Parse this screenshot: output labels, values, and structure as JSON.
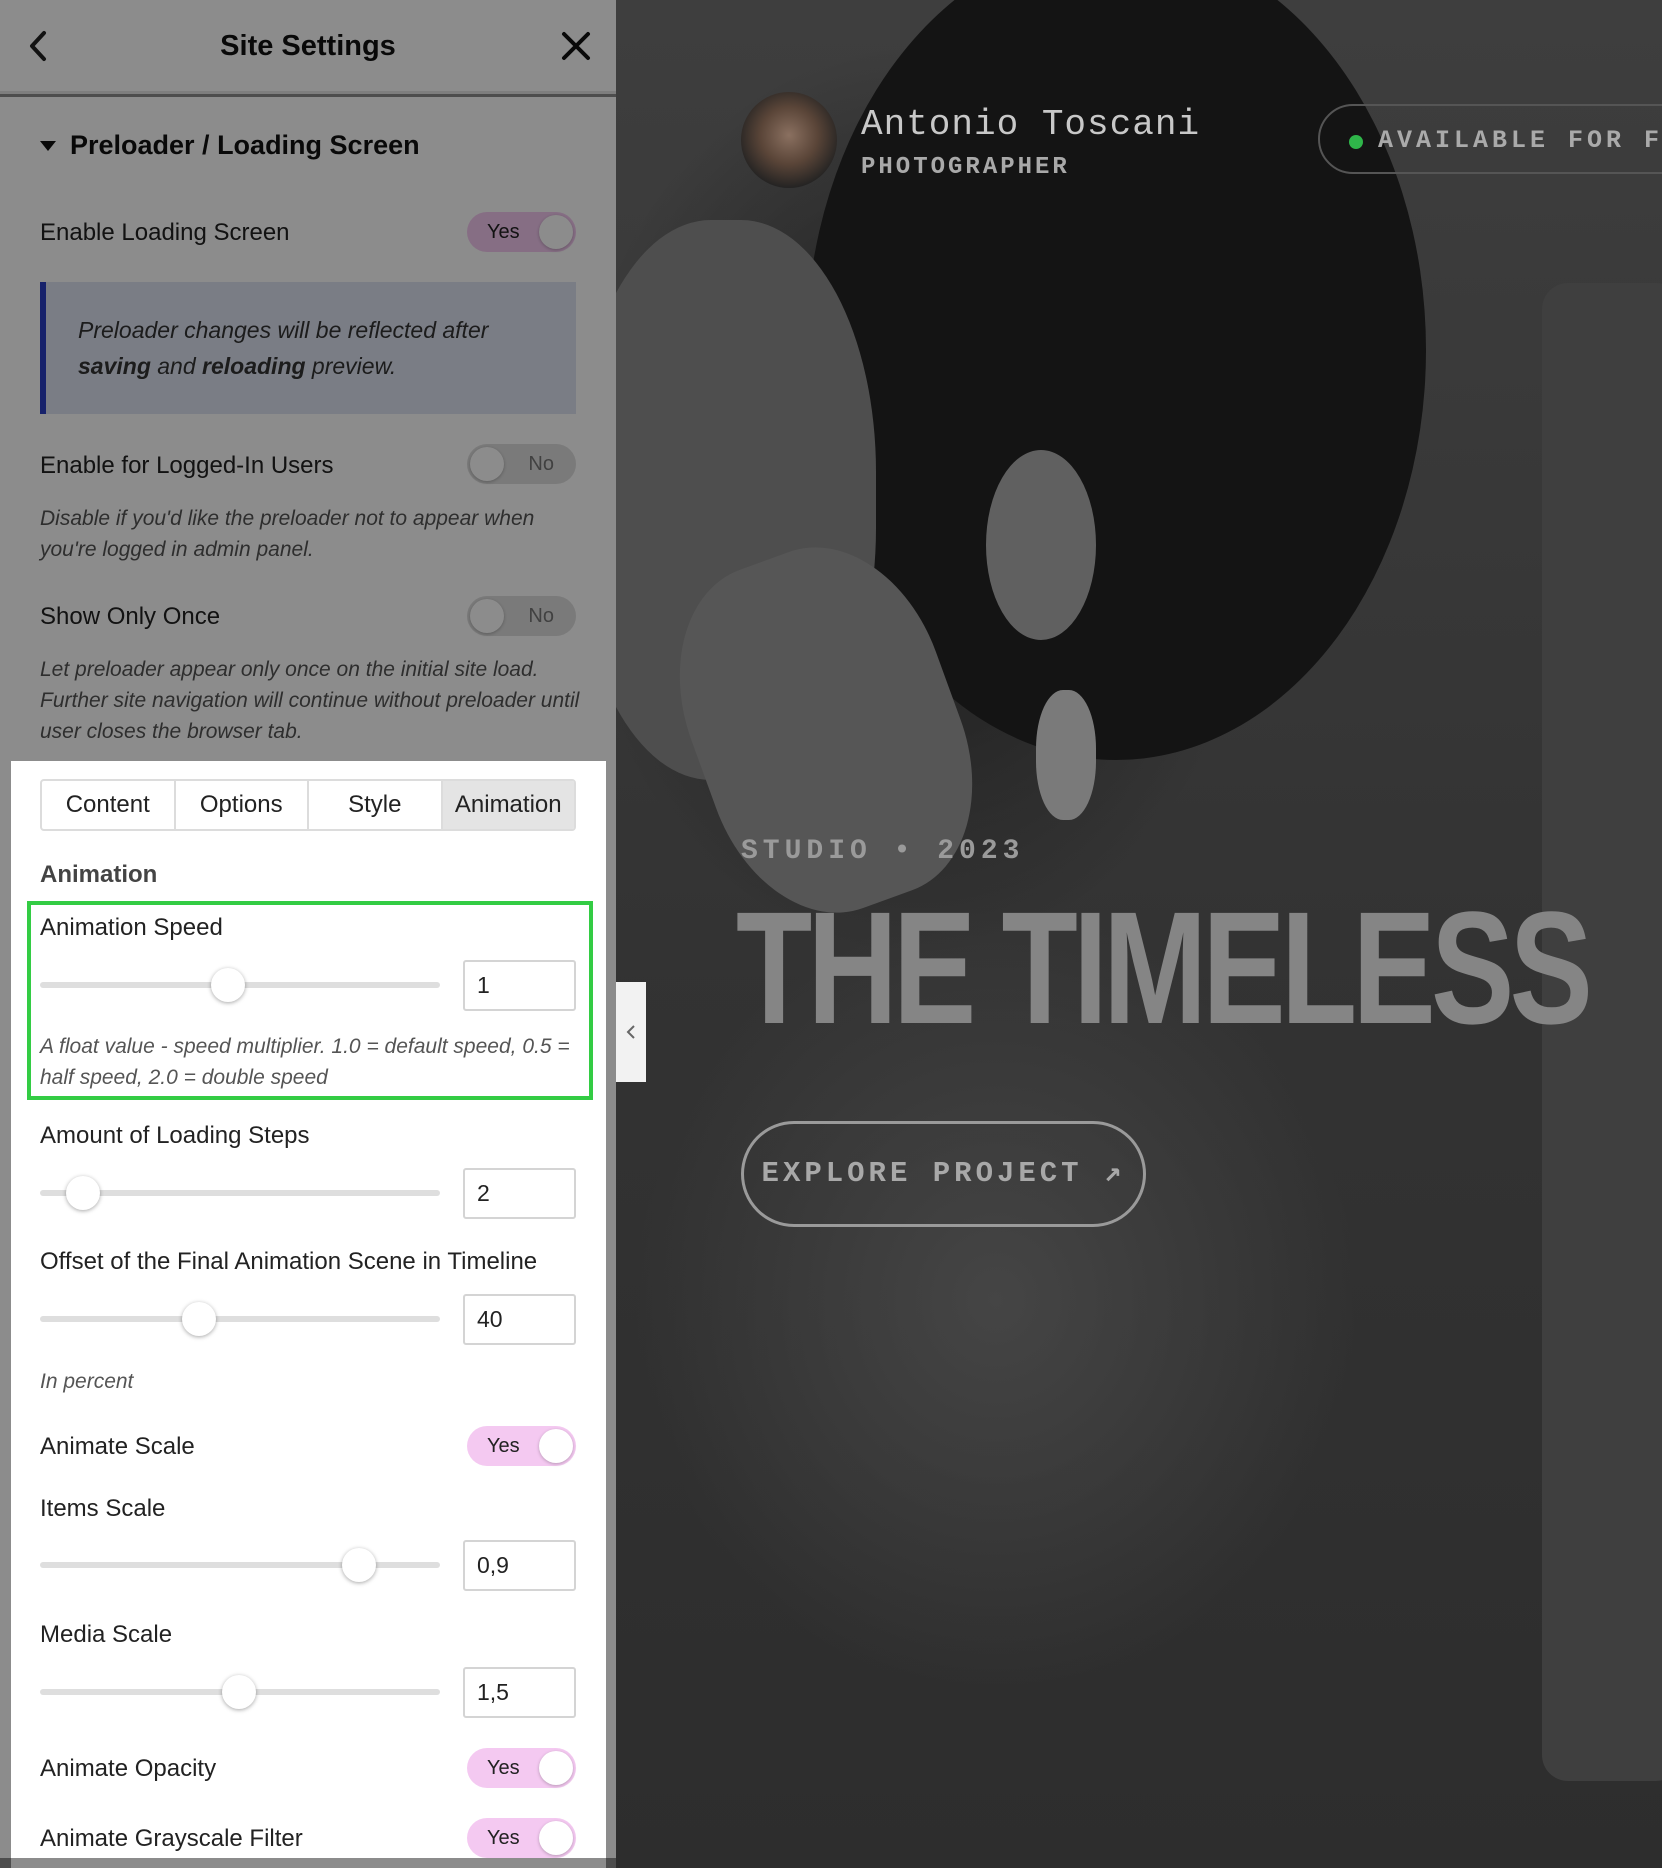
{
  "header": {
    "title": "Site Settings"
  },
  "section": {
    "title": "Preloader / Loading Screen"
  },
  "settings": {
    "enable_loading": {
      "label": "Enable Loading Screen",
      "value": "Yes"
    },
    "notice": {
      "before": "Preloader changes will be reflected after ",
      "saving": "saving",
      "and": " and ",
      "reloading": "reloading",
      "after": " preview."
    },
    "logged_in": {
      "label": "Enable for Logged-In Users",
      "value": "No",
      "help": "Disable if you'd like the preloader not to appear when you're logged in admin panel."
    },
    "show_once": {
      "label": "Show Only Once",
      "value": "No",
      "help": "Let preloader appear only once on the initial site load. Further site navigation will continue without preloader until user closes the browser tab."
    }
  },
  "tabs": [
    "Content",
    "Options",
    "Style",
    "Animation"
  ],
  "active_tab": "Animation",
  "animation": {
    "heading": "Animation",
    "speed": {
      "label": "Animation Speed",
      "value": "1",
      "help": "A float value - speed multiplier. 1.0 = default speed, 0.5 = half speed, 2.0 = double speed",
      "slider_fraction": 0.47
    },
    "steps": {
      "label": "Amount of Loading Steps",
      "value": "2",
      "slider_fraction": 0.11
    },
    "offset": {
      "label": "Offset of the Final Animation Scene in Timeline",
      "value": "40",
      "help": "In percent",
      "slider_fraction": 0.4
    },
    "animate_scale": {
      "label": "Animate Scale",
      "value": "Yes"
    },
    "items_scale": {
      "label": "Items Scale",
      "value": "0,9",
      "slider_fraction": 0.8
    },
    "media_scale": {
      "label": "Media Scale",
      "value": "1,5",
      "slider_fraction": 0.5
    },
    "animate_opacity": {
      "label": "Animate Opacity",
      "value": "Yes"
    },
    "animate_grayscale": {
      "label": "Animate Grayscale Filter",
      "value": "Yes"
    }
  },
  "preview": {
    "name": "Antonio Toscani",
    "role": "PHOTOGRAPHER",
    "availability": "AVAILABLE FOR FRE",
    "studio": "STUDIO • 2023",
    "headline": "THE TIMELESS",
    "cta": "EXPLORE PROJECT ↗"
  },
  "colors": {
    "accent_toggle": "#f4c9f1",
    "highlight": "#33cc44",
    "notice_border": "#2b3fc4",
    "status_dot": "#2fb64a"
  }
}
